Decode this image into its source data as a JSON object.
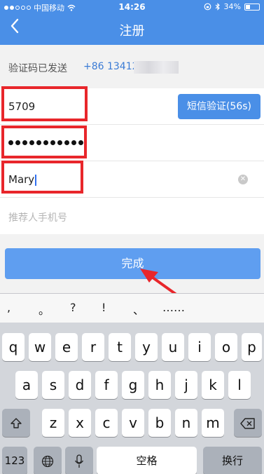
{
  "status_bar": {
    "carrier": "中国移动",
    "time": "14:26",
    "battery": "34%",
    "battery_level": 0.34
  },
  "nav": {
    "back_icon": "chevron-left-icon",
    "title": "注册"
  },
  "sent_info": {
    "label": "验证码已发送",
    "phone": "+86 13412"
  },
  "form": {
    "code_value": "5709",
    "sms_button": "短信验证(56s)",
    "password_dots": 11,
    "name_value": "Mary",
    "referrer_placeholder": "推荐人手机号"
  },
  "submit_label": "完成",
  "keyboard": {
    "punctuation": [
      ",",
      "。",
      "?",
      "!",
      "、",
      "……"
    ],
    "row1": [
      "q",
      "w",
      "e",
      "r",
      "t",
      "y",
      "u",
      "i",
      "o",
      "p"
    ],
    "row2": [
      "a",
      "s",
      "d",
      "f",
      "g",
      "h",
      "j",
      "k",
      "l"
    ],
    "row3": [
      "z",
      "x",
      "c",
      "v",
      "b",
      "n",
      "m"
    ],
    "numbers_key": "123",
    "space_key": "空格",
    "return_key": "换行",
    "shift_icon": "shift-icon",
    "delete_icon": "delete-icon",
    "globe_icon": "globe-icon",
    "mic_icon": "microphone-icon"
  },
  "colors": {
    "accent": "#4a8fe7",
    "highlight": "#e8262b"
  }
}
